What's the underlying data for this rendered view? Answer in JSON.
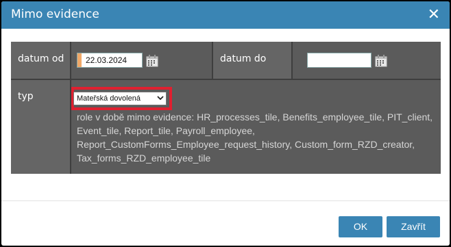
{
  "dialog": {
    "title": "Mimo evidence",
    "close_icon": "close-icon",
    "close_glyph": "✕"
  },
  "form": {
    "date_from_label": "datum od",
    "date_from_value": "22.03.2024",
    "date_to_label": "datum do",
    "date_to_value": "",
    "type_label": "typ",
    "type_selected": "Mateřská dovolená",
    "roles_text": "role v době mimo evidence: HR_processes_tile, Benefits_employee_tile, PIT_client, Event_tile, Report_tile, Payroll_employee, Report_CustomForms_Employee_request_history, Custom_form_RZD_creator, Tax_forms_RZD_employee_tile",
    "calendar_icon": "calendar-icon"
  },
  "buttons": {
    "ok_label": "OK",
    "close_label": "Zavřít"
  },
  "colors": {
    "titlebar": "#3a85b4",
    "panel": "#5b5b5b",
    "highlight": "#e02030",
    "button": "#3a85b4"
  }
}
